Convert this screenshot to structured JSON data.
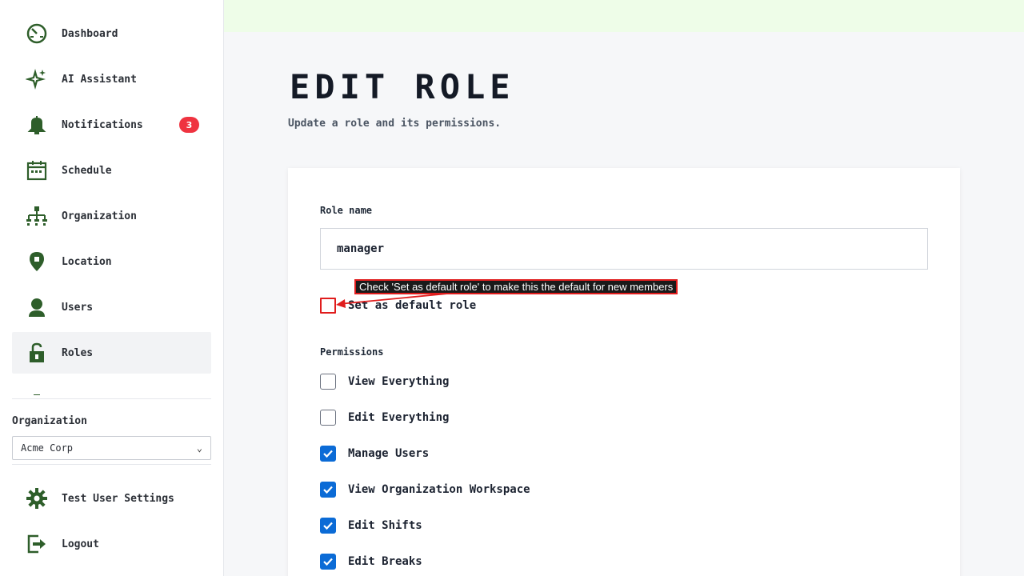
{
  "sidebar": {
    "items": [
      {
        "label": "Dashboard",
        "icon": "dashboard-gauge-icon"
      },
      {
        "label": "AI Assistant",
        "icon": "sparkle-icon"
      },
      {
        "label": "Notifications",
        "icon": "bell-icon",
        "badge": "3"
      },
      {
        "label": "Schedule",
        "icon": "calendar-icon"
      },
      {
        "label": "Organization",
        "icon": "org-chart-icon"
      },
      {
        "label": "Location",
        "icon": "map-pin-icon"
      },
      {
        "label": "Users",
        "icon": "user-icon"
      },
      {
        "label": "Roles",
        "icon": "unlock-icon",
        "active": true
      }
    ],
    "organization": {
      "label": "Organization",
      "selected": "Acme Corp"
    },
    "footer_items": [
      {
        "label": "Test User Settings",
        "icon": "gear-icon"
      },
      {
        "label": "Logout",
        "icon": "logout-icon"
      }
    ]
  },
  "main": {
    "title": "EDIT ROLE",
    "subtitle": "Update a role and its permissions.",
    "form": {
      "role_name_label": "Role name",
      "role_name_value": "manager",
      "default_role_label": "Set as default role",
      "default_role_checked": false,
      "permissions_label": "Permissions",
      "permissions": [
        {
          "label": "View Everything",
          "checked": false
        },
        {
          "label": "Edit Everything",
          "checked": false
        },
        {
          "label": "Manage Users",
          "checked": true
        },
        {
          "label": "View Organization Workspace",
          "checked": true
        },
        {
          "label": "Edit Shifts",
          "checked": true
        },
        {
          "label": "Edit Breaks",
          "checked": true
        }
      ]
    }
  },
  "annotation": {
    "text": "Check 'Set as default role' to make this the default for new members"
  },
  "colors": {
    "icon_green": "#2e5e2a",
    "topbar": "#eefde8",
    "checkbox_blue": "#0b6bd6",
    "badge_red": "#ef3340",
    "annotation_red": "#e01d1d"
  }
}
